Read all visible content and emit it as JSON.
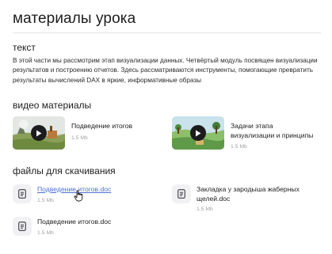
{
  "page": {
    "title": "материалы урока"
  },
  "text_section": {
    "heading": "текст",
    "body": "В этой части мы рассмотрим этап визуализации данных. Четвёртый модуль посвящен визуализации результатов и построению отчетов. Здесь рассматриваются инструменты, помогающие превратить результаты вычислений DAX в яркие, информативные образы"
  },
  "video_section": {
    "heading": "видео материалы",
    "items": [
      {
        "title": "Подведение итогов",
        "size": "1.5 Mb",
        "icon": "play-icon"
      },
      {
        "title": "Задачи этапа визуализации и принципы",
        "size": "1.5 Mb",
        "icon": "play-icon"
      }
    ]
  },
  "files_section": {
    "heading": "файлы для скачивания",
    "items": [
      {
        "name": "Подведение итогов.doc",
        "size": "1.5 Mb",
        "icon": "document-icon",
        "state": "hovered"
      },
      {
        "name": "Закладка у зародыша жаберных щелей.doc",
        "size": "1.5 Mb",
        "icon": "document-icon"
      },
      {
        "name": "Подведение итогов.doc",
        "size": "1.5 Mb",
        "icon": "document-icon"
      }
    ]
  },
  "colors": {
    "link": "#4e6fd6",
    "muted": "#a2a2a8",
    "icon_bg": "#f1f1f4",
    "divider": "#e6e6ea"
  }
}
